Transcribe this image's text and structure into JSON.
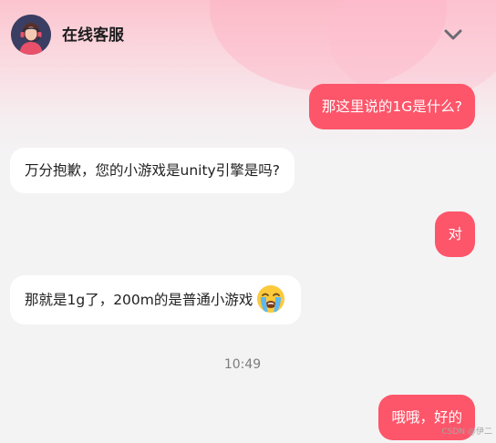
{
  "header": {
    "title": "在线客服",
    "collapse_icon": "chevron-down-icon",
    "avatar_icon": "agent-avatar"
  },
  "messages": [
    {
      "sender": "user",
      "text": "那这里说的1G是什么?"
    },
    {
      "sender": "agent",
      "text": "万分抱歉，您的小游戏是unity引擎是吗?"
    },
    {
      "sender": "user",
      "text": "对"
    },
    {
      "sender": "agent",
      "text": "那就是1g了，200m的是普通小游戏",
      "emoji": "loudly-crying-face"
    },
    {
      "sender": "user",
      "text": "哦哦，好的"
    }
  ],
  "timestamp": "10:49",
  "watermark": "CSDN @伊二",
  "colors": {
    "user_bubble": "#fd5569",
    "agent_bubble": "#ffffff",
    "header_gradient_top": "#fbc4cf",
    "background": "#f4f3f4"
  }
}
